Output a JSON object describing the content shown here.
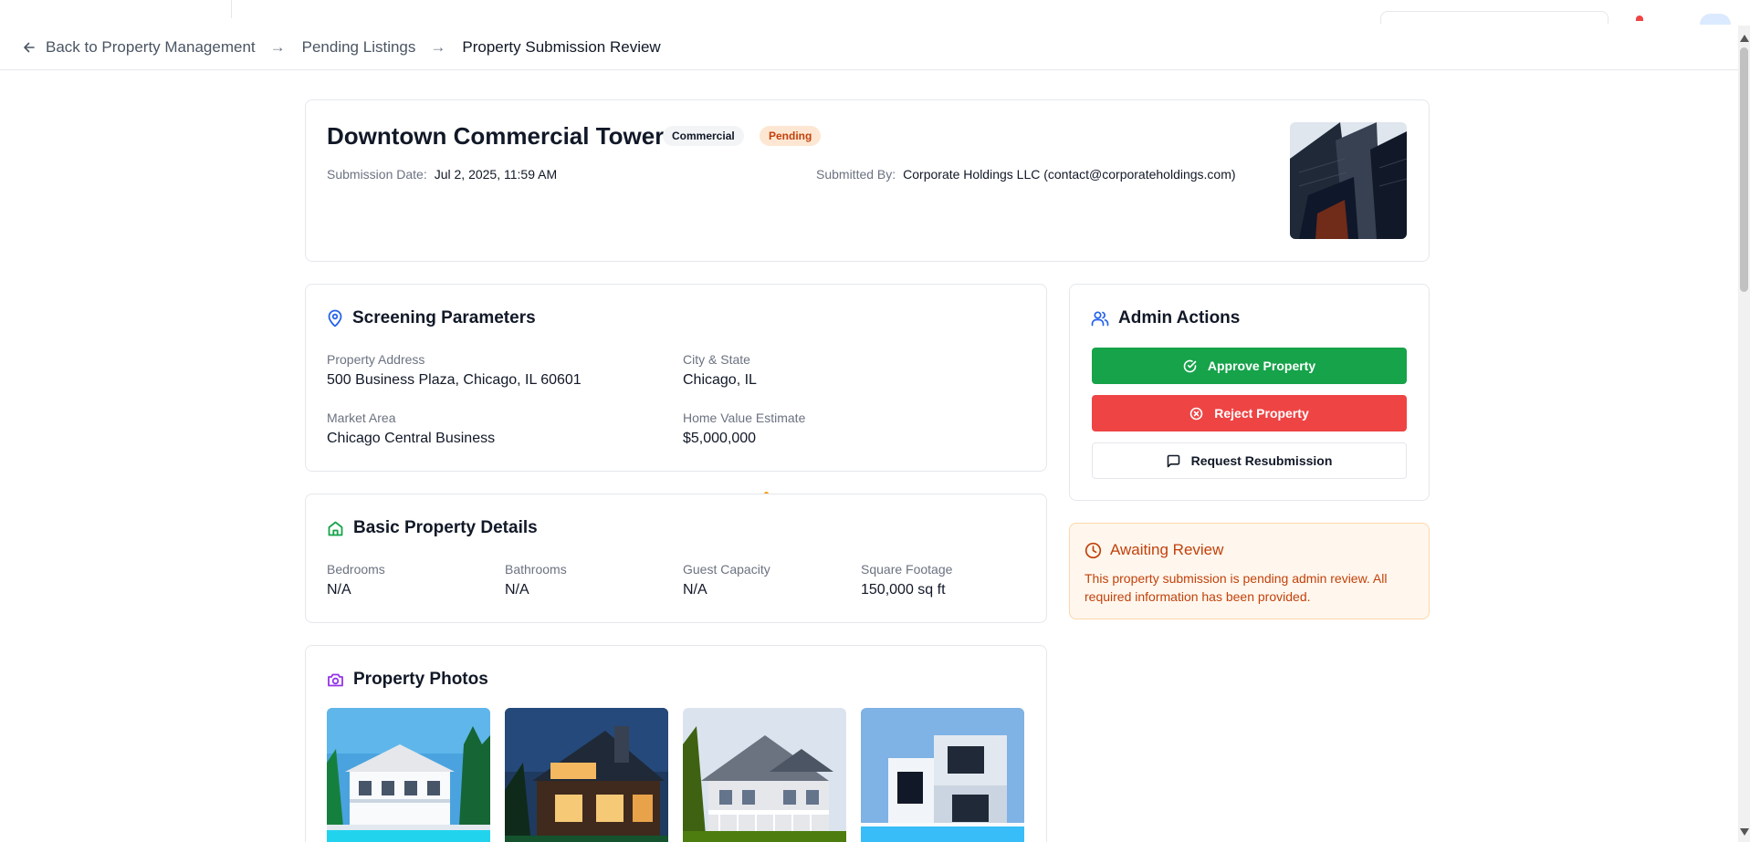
{
  "breadcrumb": {
    "back_label": "Back to Property Management",
    "separator": "→",
    "pending_label": "Pending Listings",
    "current_label": "Property Submission Review"
  },
  "property": {
    "title": "Downtown Commercial Tower",
    "type_badge": "Commercial",
    "status_badge": "Pending",
    "submission_date_label": "Submission Date:",
    "submission_date": "Jul 2, 2025, 11:59 AM",
    "submitted_by_label": "Submitted By:",
    "submitted_by": "Corporate Holdings LLC (contact@corporateholdings.com)"
  },
  "screening": {
    "title": "Screening Parameters",
    "fields": [
      {
        "label": "Property Address",
        "value": "500 Business Plaza, Chicago, IL 60601"
      },
      {
        "label": "City & State",
        "value": "Chicago, IL"
      },
      {
        "label": "Market Area",
        "value": "Chicago Central Business"
      },
      {
        "label": "Home Value Estimate",
        "value": "$5,000,000"
      }
    ]
  },
  "basic": {
    "title": "Basic Property Details",
    "fields": [
      {
        "label": "Bedrooms",
        "value": "N/A"
      },
      {
        "label": "Bathrooms",
        "value": "N/A"
      },
      {
        "label": "Guest Capacity",
        "value": "N/A"
      },
      {
        "label": "Square Footage",
        "value": "150,000 sq ft"
      }
    ]
  },
  "photos": {
    "title": "Property Photos",
    "count_visible": 4
  },
  "admin": {
    "title": "Admin Actions",
    "approve_label": "Approve Property",
    "reject_label": "Reject Property",
    "resubmit_label": "Request Resubmission"
  },
  "status_panel": {
    "title": "Awaiting Review",
    "description": "This property submission is pending admin review. All required information has been provided."
  },
  "colors": {
    "approve": "#16a34a",
    "reject": "#ef4444",
    "pending_bg": "#fde7d3",
    "pending_text": "#c2410c",
    "screening_icon": "#2563eb",
    "basic_icon": "#16a34a",
    "photos_icon": "#9333ea",
    "admin_icon": "#2563eb"
  }
}
